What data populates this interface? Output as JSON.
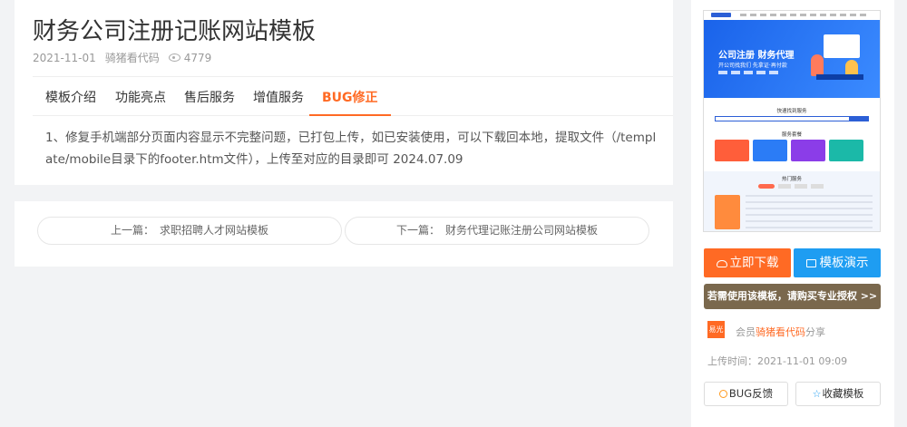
{
  "article": {
    "title": "财务公司注册记账网站模板",
    "date": "2021-11-01",
    "author": "骑猪看代码",
    "views": "4779"
  },
  "tabs": [
    {
      "label": "模板介绍",
      "active": false
    },
    {
      "label": "功能亮点",
      "active": false
    },
    {
      "label": "售后服务",
      "active": false
    },
    {
      "label": "增值服务",
      "active": false
    },
    {
      "label": "BUG修正",
      "active": true
    }
  ],
  "content": {
    "text": "1、修复手机端部分页面内容显示不完整问题，已打包上传，如已安装使用，可以下载回本地，提取文件（/template/mobile目录下的footer.htm文件），上传至对应的目录即可 2024.07.09"
  },
  "pager": {
    "prev_label": "上一篇：",
    "prev_title": "求职招聘人才网站模板",
    "next_label": "下一篇：",
    "next_title": "财务代理记账注册公司网站模板"
  },
  "preview": {
    "banner_title": "公司注册 财务代理",
    "banner_sub": "开公司找我们 先拿证·再付款",
    "section1": "快速找到服务",
    "section2": "服务套餐",
    "section3": "热门服务"
  },
  "sidebar": {
    "download": "立即下载",
    "demo": "模板演示",
    "license": "若需使用该模板，请购买专业授权 >>",
    "avatar_text": "易光",
    "member_prefix": "会员",
    "member_name": "骑猪看代码",
    "member_suffix": "分享",
    "upload_time": "上传时间：2021-11-01 09:09",
    "bug": "BUG反馈",
    "favorite": "收藏模板"
  },
  "colors": {
    "accent": "#ff6a24",
    "demo": "#1e9df2",
    "license": "#7a684d"
  }
}
